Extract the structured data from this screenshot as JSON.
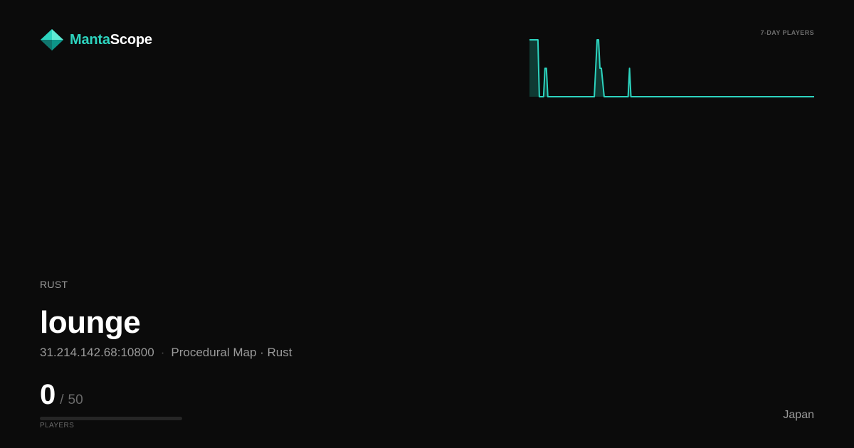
{
  "brand": {
    "name_part1": "Manta",
    "name_part2": "Scope",
    "icon": "manta-logo-icon",
    "accent_color": "#2dd4bf"
  },
  "sparkline": {
    "label": "7-DAY PLAYERS",
    "max_value": 4,
    "values": [
      4,
      4,
      4,
      4,
      4,
      4,
      4,
      0,
      0,
      0,
      0,
      2,
      2,
      0,
      0,
      0,
      0,
      0,
      0,
      0,
      0,
      0,
      0,
      0,
      0,
      0,
      0,
      0,
      0,
      0,
      0,
      0,
      0,
      0,
      0,
      0,
      0,
      0,
      0,
      0,
      0,
      0,
      0,
      0,
      0,
      0,
      0,
      2,
      4,
      4,
      2,
      2,
      1,
      0,
      0,
      0,
      0,
      0,
      0,
      0,
      0,
      0,
      0,
      0,
      0,
      0,
      0,
      0,
      0,
      0,
      0,
      2,
      0,
      0,
      0,
      0,
      0,
      0,
      0,
      0,
      0,
      0,
      0,
      0,
      0,
      0,
      0,
      0,
      0,
      0,
      0,
      0,
      0,
      0,
      0,
      0,
      0,
      0,
      0,
      0,
      0,
      0,
      0,
      0,
      0,
      0,
      0,
      0,
      0,
      0,
      0,
      0,
      0,
      0,
      0,
      0,
      0,
      0,
      0,
      0,
      0,
      0,
      0,
      0,
      0,
      0,
      0,
      0,
      0,
      0,
      0,
      0,
      0,
      0,
      0,
      0,
      0,
      0,
      0,
      0,
      0,
      0,
      0,
      0,
      0,
      0,
      0,
      0,
      0,
      0,
      0,
      0,
      0,
      0,
      0,
      0,
      0,
      0,
      0,
      0,
      0,
      0,
      0,
      0,
      0,
      0,
      0,
      0,
      0,
      0,
      0,
      0,
      0,
      0,
      0,
      0,
      0,
      0,
      0,
      0,
      0,
      0,
      0,
      0,
      0,
      0,
      0,
      0,
      0,
      0,
      0,
      0,
      0,
      0,
      0,
      0,
      0,
      0,
      0,
      0,
      0,
      0,
      0
    ],
    "line_color": "#2dd4bf",
    "fill_color": "#0f3a33"
  },
  "server": {
    "game": "RUST",
    "name": "lounge",
    "address": "31.214.142.68:10800",
    "separator": "·",
    "map": "Procedural Map · Rust",
    "country": "Japan"
  },
  "players": {
    "current": "0",
    "slash": "/",
    "max": "50",
    "fill_fraction": 0,
    "label": "PLAYERS"
  }
}
